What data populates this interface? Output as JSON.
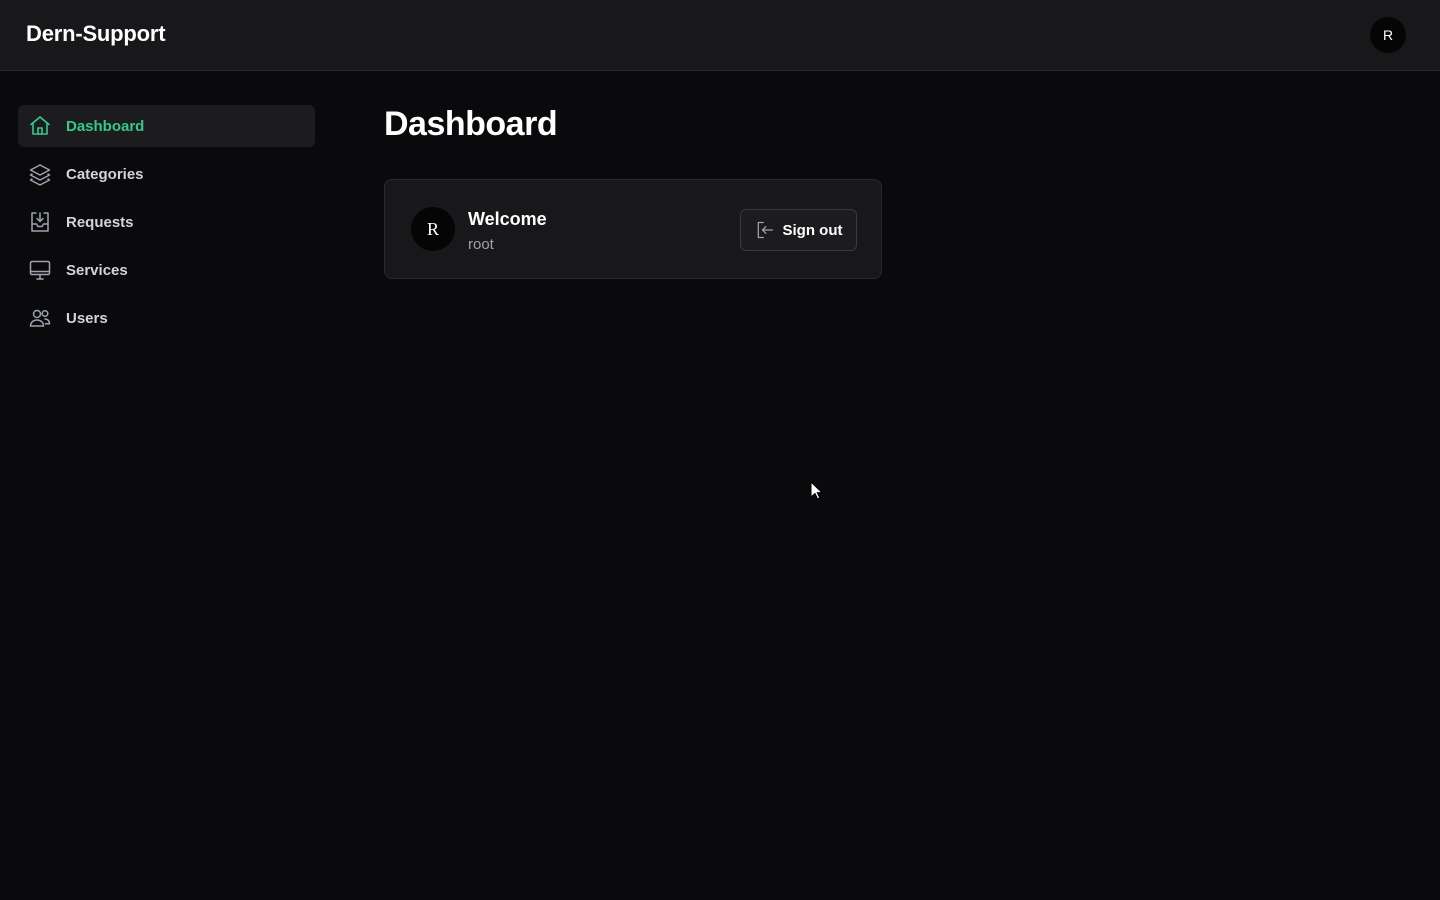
{
  "app": {
    "brand": "Dern-Support",
    "user_initial": "R",
    "accent_color": "#34c98a"
  },
  "sidebar": {
    "items": [
      {
        "label": "Dashboard",
        "icon": "home-icon",
        "active": true
      },
      {
        "label": "Categories",
        "icon": "layers-icon",
        "active": false
      },
      {
        "label": "Requests",
        "icon": "inbox-icon",
        "active": false
      },
      {
        "label": "Services",
        "icon": "monitor-icon",
        "active": false
      },
      {
        "label": "Users",
        "icon": "users-icon",
        "active": false
      }
    ]
  },
  "main": {
    "title": "Dashboard",
    "welcome_card": {
      "avatar_initial": "R",
      "heading": "Welcome",
      "username": "root",
      "signout_label": "Sign out",
      "signout_icon": "sign-out-icon"
    }
  }
}
